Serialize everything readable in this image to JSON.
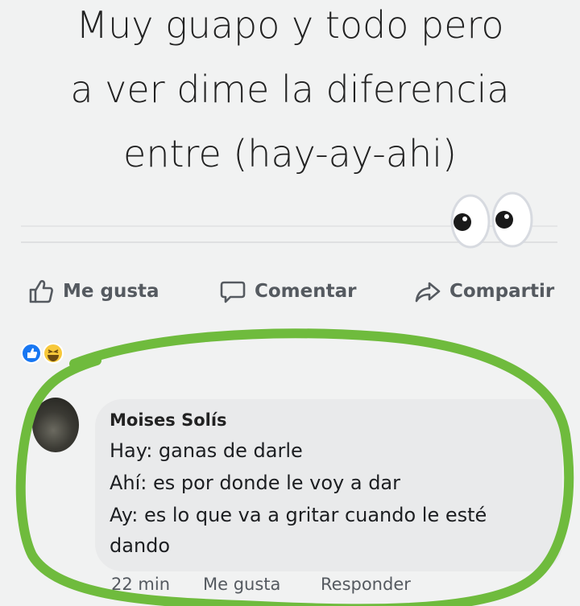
{
  "post": {
    "text_lines": [
      "Muy guapo y todo pero",
      "a ver dime la diferencia",
      "entre (hay-ay-ahi)"
    ],
    "emoji": "eyes-emoji"
  },
  "actions": {
    "like": "Me gusta",
    "comment": "Comentar",
    "share": "Compartir"
  },
  "reactions": {
    "icons": [
      "like-reaction-icon",
      "haha-reaction-icon"
    ]
  },
  "comment": {
    "author": "Moises Solís",
    "lines": [
      "Hay: ganas de darle",
      "Ahí: es por donde le voy a dar",
      "Ay: es lo que va a gritar cuando le esté",
      "dando"
    ],
    "time": "22 min",
    "like": "Me gusta",
    "reply": "Responder"
  },
  "colors": {
    "background": "#f1f2f2",
    "bubble": "#e9eaeb",
    "action_text": "#555a60",
    "like_blue": "#1877f2",
    "haha_yellow": "#f7c83a",
    "highlight_green": "#6fbb3d"
  }
}
